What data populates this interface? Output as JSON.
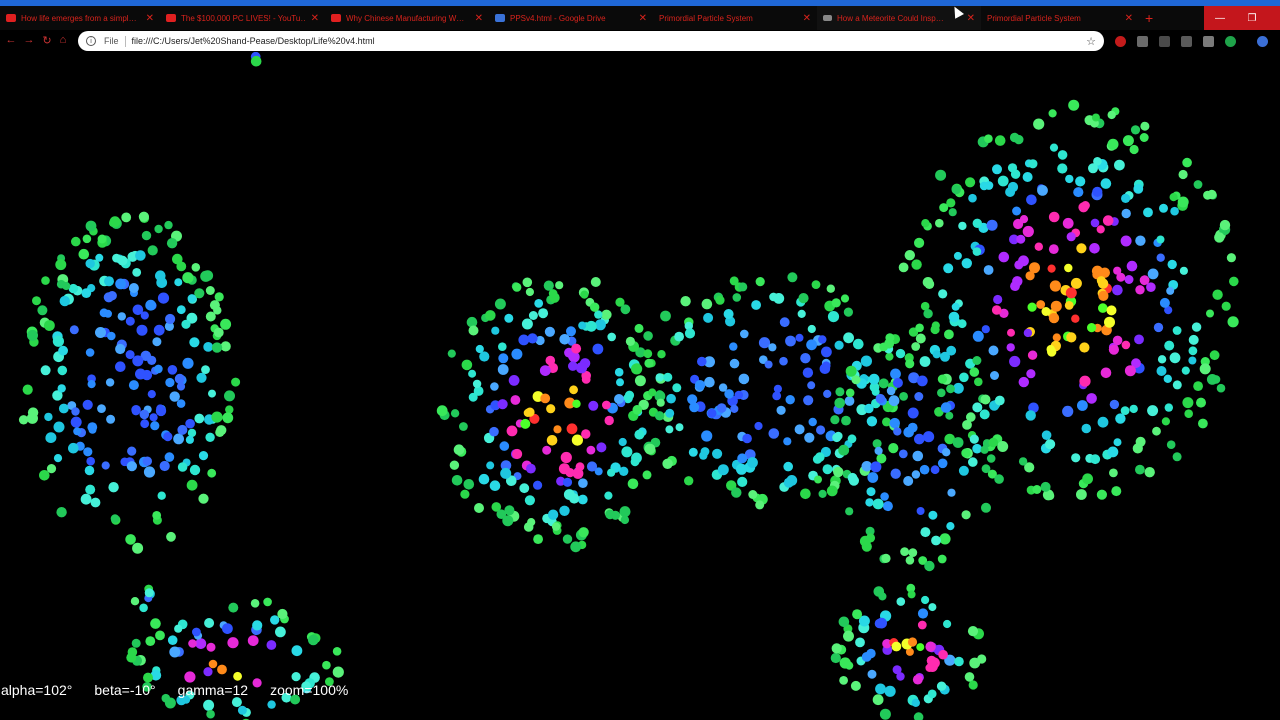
{
  "browser": {
    "tabs": [
      {
        "title": "How life emerges from a simpl…",
        "favicon": "youtube-icon"
      },
      {
        "title": "The $100,000 PC LIVES! - YouTu…",
        "favicon": "youtube-icon"
      },
      {
        "title": "Why Chinese Manufacturing W…",
        "favicon": "youtube-icon"
      },
      {
        "title": "PPSv4.html - Google Drive",
        "favicon": "google-drive-icon"
      },
      {
        "title": "Primordial Particle System",
        "favicon": "page-icon"
      },
      {
        "title": "How a Meteorite Could Insp…",
        "favicon": "generic-icon"
      },
      {
        "title": "Primordial Particle System",
        "favicon": "page-icon"
      }
    ],
    "new_tab_label": "+",
    "address": {
      "scheme_label": "File",
      "url": "file:///C:/Users/Jet%20Shand-Pease/Desktop/Life%20v4.html"
    },
    "window_controls": {
      "minimize": "—",
      "maximize": "❐",
      "close": "✕"
    }
  },
  "page": {
    "hud": {
      "alpha": "alpha=102°",
      "beta": "beta=-10°",
      "gamma": "gamma=12",
      "zoom": "zoom=100%"
    }
  },
  "colors": {
    "background": "#000000",
    "tab_accent": "#1f67d6",
    "tab_text": "#d8231c",
    "window_control_bg": "#c4161c"
  }
}
